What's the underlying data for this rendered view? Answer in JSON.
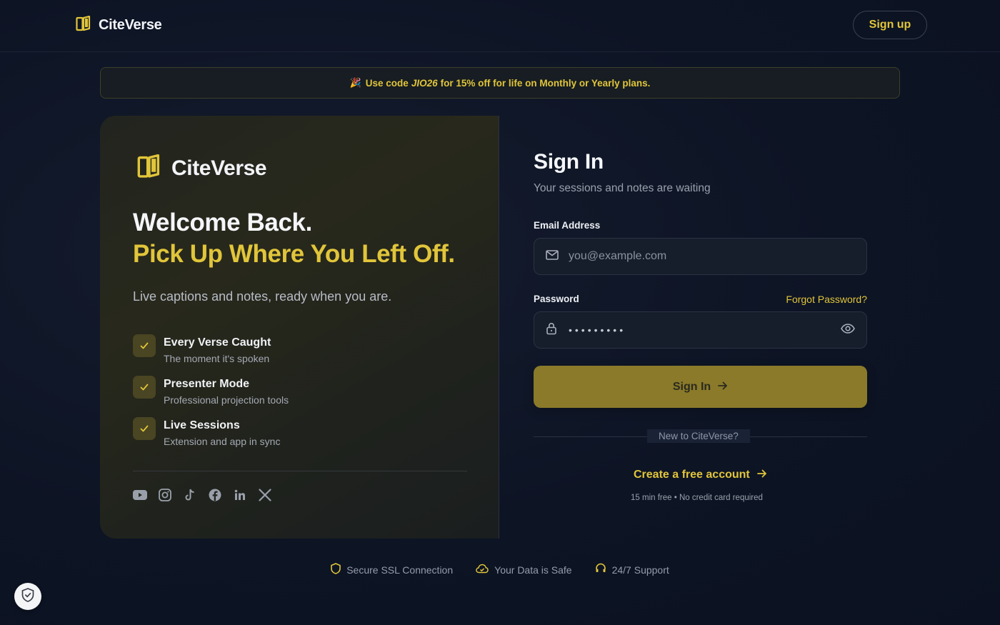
{
  "header": {
    "brand": "CiteVerse",
    "signup_label": "Sign up"
  },
  "promo": {
    "prefix": "Use code",
    "code": "JIO26",
    "suffix": "for 15% off for life on Monthly or Yearly plans."
  },
  "left": {
    "brand": "CiteVerse",
    "headline": "Welcome Back.",
    "headline_accent": "Pick Up Where You Left Off.",
    "subtitle": "Live captions and notes, ready when you are.",
    "features": [
      {
        "title": "Every Verse Caught",
        "desc": "The moment it's spoken"
      },
      {
        "title": "Presenter Mode",
        "desc": "Professional projection tools"
      },
      {
        "title": "Live Sessions",
        "desc": "Extension and app in sync"
      }
    ],
    "socials": [
      "youtube-icon",
      "instagram-icon",
      "tiktok-icon",
      "facebook-icon",
      "linkedin-icon",
      "x-icon"
    ]
  },
  "form": {
    "title": "Sign In",
    "subtitle": "Your sessions and notes are waiting",
    "email_label": "Email Address",
    "email_placeholder": "you@example.com",
    "password_label": "Password",
    "password_value": "•••••••••",
    "forgot_label": "Forgot Password?",
    "submit_label": "Sign In",
    "divider_label": "New to CiteVerse?",
    "create_label": "Create a free account",
    "create_note": "15 min free • No credit card required"
  },
  "footer": {
    "items": [
      "Secure SSL Connection",
      "Your Data is Safe",
      "24/7 Support"
    ]
  },
  "colors": {
    "accent": "#e1c53a",
    "button": "#8a7a2a",
    "background": "#0d1424"
  }
}
